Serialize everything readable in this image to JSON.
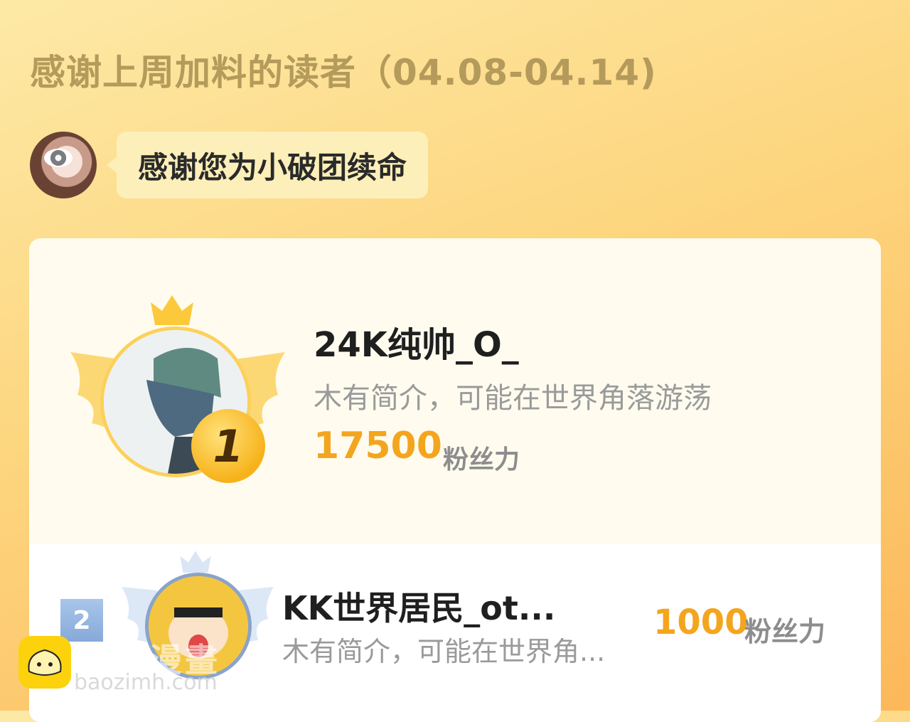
{
  "header": {
    "title": "感谢上周加料的读者（04.08-04.14)"
  },
  "thanks": {
    "message": "感谢您为小破团续命"
  },
  "leaderboard": [
    {
      "rank": "1",
      "name": "24K纯帅_O_",
      "bio": "木有简介，可能在世界角落游荡",
      "score": "17500",
      "unit": "粉丝力"
    },
    {
      "rank": "2",
      "name": "KK世界居民_ot...",
      "bio": "木有简介，可能在世界角...",
      "score": "1000",
      "unit": "粉丝力"
    }
  ],
  "watermark": {
    "name": "包子漫畫",
    "url": "baozimh.com"
  },
  "colors": {
    "accent": "#f4a51e",
    "gold": "#fcd15b",
    "rank2": "#86a9d8"
  }
}
